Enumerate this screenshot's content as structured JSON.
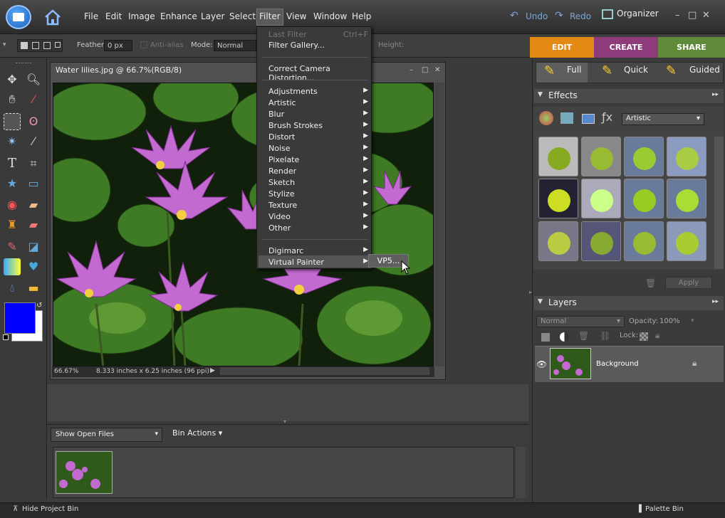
{
  "menubar": {
    "items": [
      "File",
      "Edit",
      "Image",
      "Enhance",
      "Layer",
      "Select",
      "Filter",
      "View",
      "Window",
      "Help"
    ],
    "active": "Filter"
  },
  "top_actions": {
    "undo": "Undo",
    "redo": "Redo",
    "organizer": "Organizer"
  },
  "options_bar": {
    "feather_label": "Feather:",
    "feather_value": "0 px",
    "antialias": "Anti-alias",
    "mode_label": "Mode:",
    "mode_value": "Normal",
    "height_label": "Height:"
  },
  "mode_tabs": [
    {
      "label": "EDIT",
      "color": "#e38a14"
    },
    {
      "label": "CREATE",
      "color": "#8e3b7c"
    },
    {
      "label": "SHARE",
      "color": "#5e8a3a"
    }
  ],
  "edit_tabs": {
    "full": "Full",
    "quick": "Quick",
    "guided": "Guided"
  },
  "document": {
    "title": "Water lilies.jpg @ 66.7%(RGB/8)",
    "zoom": "66.67%",
    "info": "8.333 inches x 6.25 inches (96 ppi)"
  },
  "filter_menu": {
    "last_filter": "Last Filter",
    "last_filter_shortcut": "Ctrl+F",
    "gallery": "Filter Gallery...",
    "camera": "Correct Camera Distortion...",
    "groups": [
      "Adjustments",
      "Artistic",
      "Blur",
      "Brush Strokes",
      "Distort",
      "Noise",
      "Pixelate",
      "Render",
      "Sketch",
      "Stylize",
      "Texture",
      "Video",
      "Other"
    ],
    "plugins": [
      "Digimarc",
      "Virtual Painter"
    ]
  },
  "submenu": {
    "item": "VP5..."
  },
  "effects": {
    "header": "Effects",
    "category": "Artistic",
    "apply": "Apply"
  },
  "layers": {
    "header": "Layers",
    "blend": "Normal",
    "opacity_label": "Opacity:",
    "opacity_value": "100%",
    "lock_label": "Lock:",
    "layer_name": "Background"
  },
  "project_bin": {
    "show": "Show Open Files",
    "actions": "Bin Actions"
  },
  "statusbar": {
    "hide_bin": "Hide Project Bin",
    "palette_bin": "Palette Bin"
  },
  "colors": {
    "foreground": "#0000ff",
    "background": "#ffffff"
  }
}
